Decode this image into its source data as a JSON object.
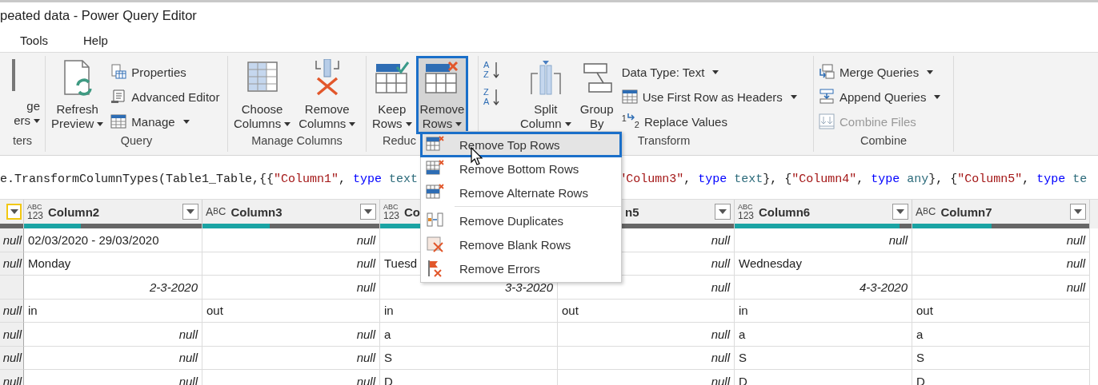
{
  "window": {
    "title": "peated data - Power Query Editor"
  },
  "menu": [
    "Tools",
    "Help"
  ],
  "ribbon": {
    "groups": [
      {
        "label": "ters",
        "large": [
          {
            "lines": [
              "ge",
              "ers"
            ],
            "has_menu": true,
            "selected": false
          }
        ]
      },
      {
        "label": "Query",
        "large": [
          {
            "lines": [
              "Refresh",
              "Preview"
            ],
            "has_menu": true,
            "selected": false
          }
        ],
        "small": [
          {
            "label": "Properties",
            "has_menu": false,
            "disabled": false
          },
          {
            "label": "Advanced Editor",
            "has_menu": false,
            "disabled": false
          },
          {
            "label": "Manage",
            "has_menu": true,
            "disabled": false
          }
        ]
      },
      {
        "label": "Manage Columns",
        "large": [
          {
            "lines": [
              "Choose",
              "Columns"
            ],
            "has_menu": true,
            "selected": false
          },
          {
            "lines": [
              "Remove",
              "Columns"
            ],
            "has_menu": true,
            "selected": false
          }
        ]
      },
      {
        "label": "Reduc",
        "large": [
          {
            "lines": [
              "Keep",
              "Rows"
            ],
            "has_menu": true,
            "selected": false
          },
          {
            "lines": [
              "Remove",
              "Rows"
            ],
            "has_menu": true,
            "selected": true
          }
        ]
      },
      {
        "small": [
          {
            "glyphs": [
              "A",
              "Z"
            ],
            "has_menu": false
          },
          {
            "glyphs": [
              "Z",
              "A"
            ],
            "has_menu": false
          }
        ]
      },
      {
        "label": "Transform",
        "large": [
          {
            "lines": [
              "Split",
              "Column"
            ],
            "has_menu": true,
            "selected": false
          },
          {
            "lines": [
              "Group",
              "By"
            ],
            "has_menu": false,
            "selected": false
          }
        ],
        "small": [
          {
            "label": "Data Type: Text",
            "has_menu": true,
            "disabled": false
          },
          {
            "label": "Use First Row as Headers",
            "has_menu": true,
            "disabled": false
          },
          {
            "label": "Replace Values",
            "glyphs": [
              "1",
              "2"
            ],
            "has_menu": false,
            "disabled": false
          }
        ]
      },
      {
        "label": "Combine",
        "small": [
          {
            "label": "Merge Queries",
            "has_menu": true,
            "disabled": false
          },
          {
            "label": "Append Queries",
            "has_menu": true,
            "disabled": false
          },
          {
            "label": "Combine Files",
            "has_menu": false,
            "disabled": true
          }
        ]
      }
    ]
  },
  "formula": {
    "left": [
      {
        "kind": "plain",
        "text": "e.TransformColumnTypes(Table1_Table,{{"
      },
      {
        "kind": "string",
        "text": "\"Column1\""
      },
      {
        "kind": "plain",
        "text": ", "
      },
      {
        "kind": "keyword",
        "text": "type "
      },
      {
        "kind": "type",
        "text": "text"
      }
    ],
    "right": [
      {
        "kind": "string",
        "text": "\"Column3\""
      },
      {
        "kind": "plain",
        "text": ", "
      },
      {
        "kind": "keyword",
        "text": "type "
      },
      {
        "kind": "type",
        "text": "text"
      },
      {
        "kind": "plain",
        "text": "}, {"
      },
      {
        "kind": "string",
        "text": "\"Column4\""
      },
      {
        "kind": "plain",
        "text": ", "
      },
      {
        "kind": "keyword",
        "text": "type "
      },
      {
        "kind": "type",
        "text": "any"
      },
      {
        "kind": "plain",
        "text": "}, {"
      },
      {
        "kind": "string",
        "text": "\"Column5\""
      },
      {
        "kind": "plain",
        "text": ", "
      },
      {
        "kind": "keyword",
        "text": "type "
      },
      {
        "kind": "type",
        "text": "te"
      }
    ]
  },
  "table": {
    "columns": [
      {
        "kind": "partial",
        "selected": true
      },
      {
        "kind": "any",
        "glyph": [
          "ABC",
          "123"
        ],
        "label": "Column2",
        "selected": false,
        "level": 0.32
      },
      {
        "kind": "text",
        "glyph": [
          "A",
          "B",
          "C"
        ],
        "label": "Column3",
        "selected": false,
        "level": 0.38
      },
      {
        "kind": "any",
        "glyph": [
          "ABC",
          "123"
        ],
        "label": "Co",
        "level": 0.4
      },
      {
        "kind": "clipped",
        "label": "n5",
        "selected": false,
        "level": 0.3
      },
      {
        "kind": "any",
        "glyph": [
          "ABC",
          "123"
        ],
        "label": "Column6",
        "selected": false,
        "level": 0.93
      },
      {
        "kind": "text",
        "glyph": [
          "A",
          "B",
          "C"
        ],
        "label": "Column7",
        "selected": false,
        "level": 0.45
      }
    ],
    "rows": [
      [
        {
          "kind": "typed",
          "text": "null"
        },
        {
          "kind": "text",
          "text": "02/03/2020 - 29/03/2020"
        },
        {
          "kind": "typed",
          "text": "null"
        },
        {
          "kind": "empty"
        },
        {
          "kind": "typed",
          "text": "null"
        },
        {
          "kind": "typed",
          "text": "null"
        },
        {
          "kind": "typed",
          "text": "null"
        }
      ],
      [
        {
          "kind": "typed",
          "text": "null"
        },
        {
          "kind": "text",
          "text": "Monday"
        },
        {
          "kind": "typed",
          "text": "null"
        },
        {
          "kind": "text",
          "text": "Tuesd"
        },
        {
          "kind": "typed",
          "text": "null"
        },
        {
          "kind": "text",
          "text": "Wednesday"
        },
        {
          "kind": "typed",
          "text": "null"
        }
      ],
      [
        {
          "kind": "empty"
        },
        {
          "kind": "typed",
          "text": "2-3-2020"
        },
        {
          "kind": "typed",
          "text": "null"
        },
        {
          "kind": "typed",
          "text": "3-3-2020"
        },
        {
          "kind": "typed",
          "text": "null"
        },
        {
          "kind": "typed",
          "text": "4-3-2020"
        },
        {
          "kind": "typed",
          "text": "null"
        }
      ],
      [
        {
          "kind": "typed",
          "text": "null"
        },
        {
          "kind": "text",
          "text": "in"
        },
        {
          "kind": "text",
          "text": "out"
        },
        {
          "kind": "text",
          "text": "in"
        },
        {
          "kind": "text",
          "text": "out"
        },
        {
          "kind": "text",
          "text": "in"
        },
        {
          "kind": "text",
          "text": "out"
        }
      ],
      [
        {
          "kind": "typed",
          "text": "null"
        },
        {
          "kind": "typed",
          "text": "null"
        },
        {
          "kind": "typed",
          "text": "null"
        },
        {
          "kind": "text",
          "text": "a"
        },
        {
          "kind": "typed",
          "text": "null"
        },
        {
          "kind": "text",
          "text": "a"
        },
        {
          "kind": "text",
          "text": "a"
        }
      ],
      [
        {
          "kind": "typed",
          "text": "null"
        },
        {
          "kind": "typed",
          "text": "null"
        },
        {
          "kind": "typed",
          "text": "null"
        },
        {
          "kind": "text",
          "text": "S"
        },
        {
          "kind": "typed",
          "text": "null"
        },
        {
          "kind": "text",
          "text": "S"
        },
        {
          "kind": "text",
          "text": "S"
        }
      ],
      [
        {
          "kind": "typed",
          "text": "null"
        },
        {
          "kind": "typed",
          "text": "null"
        },
        {
          "kind": "typed",
          "text": "null"
        },
        {
          "kind": "text",
          "text": "D"
        },
        {
          "kind": "typed",
          "text": "null"
        },
        {
          "kind": "text",
          "text": "D"
        },
        {
          "kind": "text",
          "text": "D"
        }
      ]
    ]
  },
  "dropdown_menu": {
    "items": [
      {
        "label": "Remove Top Rows",
        "selected": true,
        "separator_before": false
      },
      {
        "label": "Remove Bottom Rows",
        "selected": false,
        "separator_before": false
      },
      {
        "label": "Remove Alternate Rows",
        "selected": false,
        "separator_before": false
      },
      {
        "label": "Remove Duplicates",
        "selected": false,
        "separator_before": true
      },
      {
        "label": "Remove Blank Rows",
        "selected": false,
        "separator_before": false
      },
      {
        "label": "Remove Errors",
        "selected": false,
        "separator_before": false
      }
    ]
  }
}
